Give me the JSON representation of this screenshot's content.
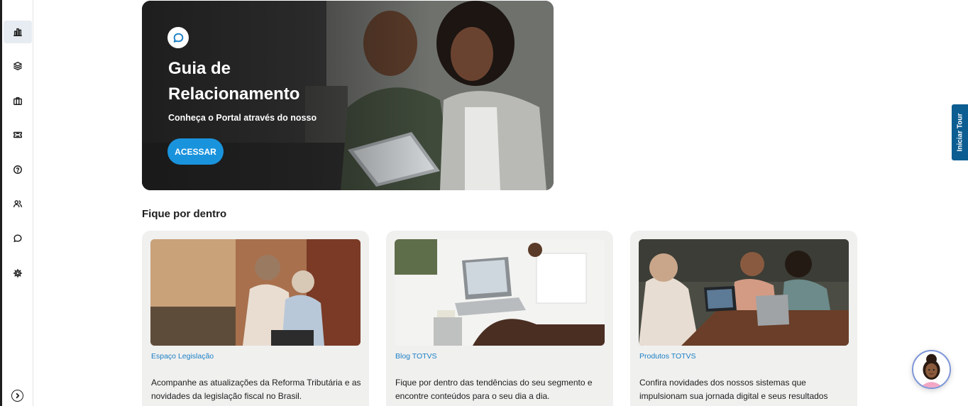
{
  "sidebar": {
    "items": [
      {
        "name": "dashboard",
        "icon": "bar-chart-icon",
        "active": true
      },
      {
        "name": "layers",
        "icon": "layers-icon",
        "active": false
      },
      {
        "name": "portfolio",
        "icon": "briefcase-icon",
        "active": false
      },
      {
        "name": "tickets",
        "icon": "ticket-icon",
        "active": false
      },
      {
        "name": "help",
        "icon": "help-circle-icon",
        "active": false
      },
      {
        "name": "users",
        "icon": "users-icon",
        "active": false
      },
      {
        "name": "chat",
        "icon": "chat-icon",
        "active": false
      },
      {
        "name": "settings",
        "icon": "gear-icon",
        "active": false
      }
    ],
    "expand_icon": "chevron-right-circle-icon"
  },
  "hero": {
    "icon": "chat-bubble-icon",
    "title": "Guia de Relacionamento",
    "subtitle": "Conheça o Portal através do nosso",
    "button_label": "ACESSAR"
  },
  "section": {
    "title": "Fique por dentro"
  },
  "cards": [
    {
      "category": "Espaço Legislação",
      "description": "Acompanhe as atualizações da Reforma Tributária e as novidades da legislação fiscal no Brasil."
    },
    {
      "category": "Blog TOTVS",
      "description": "Fique por dentro das tendências do seu segmento e encontre conteúdos para o seu dia a dia."
    },
    {
      "category": "Produtos TOTVS",
      "description": "Confira novidades dos nossos sistemas que impulsionam sua jornada digital e seus resultados financeiros."
    }
  ],
  "tour_button": {
    "label": "Iniciar Tour"
  },
  "colors": {
    "accent": "#1a93dd",
    "link": "#1a7fc4",
    "tour": "#0c5d91",
    "card_bg": "#f0f0ef"
  }
}
